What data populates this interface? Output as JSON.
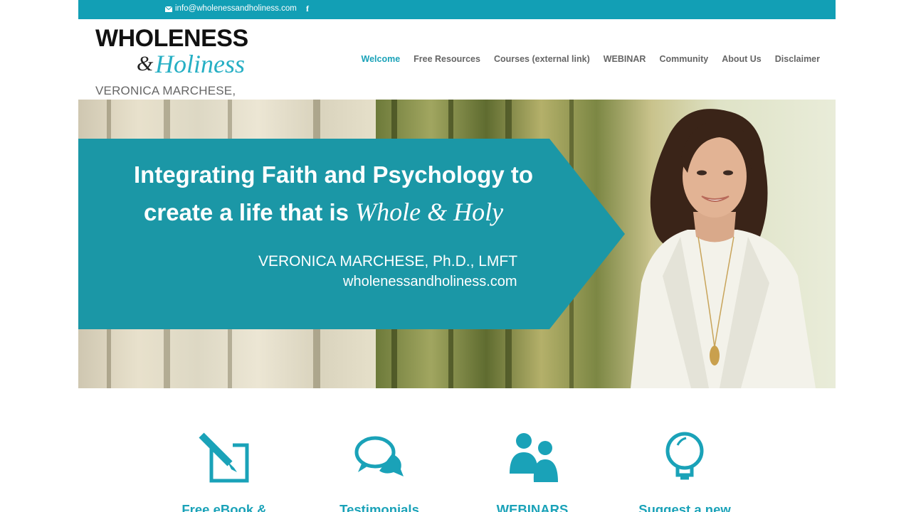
{
  "topbar": {
    "email": "info@wholenessandholiness.com",
    "icons": [
      "mail-icon",
      "facebook-icon"
    ],
    "facebook_glyph": "f"
  },
  "logo": {
    "line1": "WHOLENESS",
    "ampersand": "&",
    "line2": "Holiness",
    "line3": "VERONICA MARCHESE, Ph.D."
  },
  "nav": {
    "items": [
      {
        "label": "Welcome",
        "active": true
      },
      {
        "label": "Free Resources"
      },
      {
        "label": "Courses (external link)"
      },
      {
        "label": "WEBINAR"
      },
      {
        "label": "Community"
      },
      {
        "label": "About Us"
      },
      {
        "label": "Disclaimer"
      }
    ]
  },
  "hero": {
    "line1": "Integrating Faith and Psychology to",
    "line2_prefix": "create a life that is ",
    "line2_script": "Whole & Holy",
    "name": "VERONICA MARCHESE, Ph.D., LMFT",
    "url": "wholenessandholiness.com"
  },
  "features": [
    {
      "label": "Free eBook &",
      "icon": "edit-icon"
    },
    {
      "label": "Testimonials",
      "icon": "chat-bubbles-icon"
    },
    {
      "label": "WEBINARS",
      "icon": "people-icon"
    },
    {
      "label": "Suggest a new",
      "icon": "lightbulb-icon"
    }
  ],
  "colors": {
    "accent": "#129fb5",
    "banner": "#1b97a6",
    "nav_text": "#666666"
  }
}
